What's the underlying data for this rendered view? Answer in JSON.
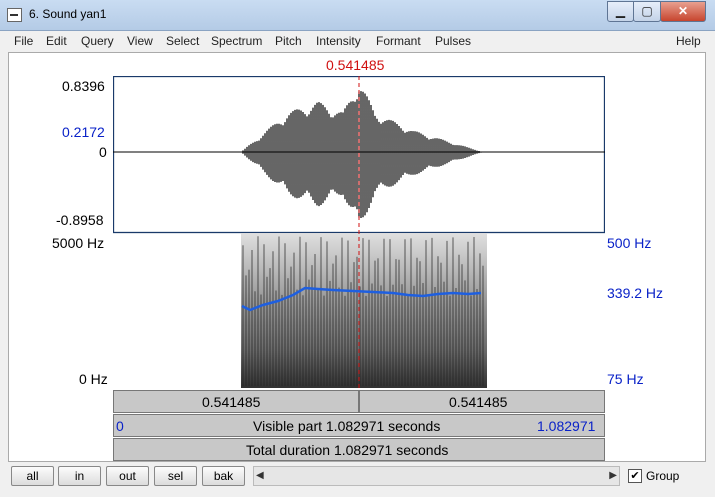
{
  "window": {
    "title": "6. Sound yan1",
    "minimize": "▁",
    "maximize": "▢",
    "close": "✕"
  },
  "menu": [
    "File",
    "Edit",
    "Query",
    "View",
    "Select",
    "Spectrum",
    "Pitch",
    "Intensity",
    "Formant",
    "Pulses"
  ],
  "help": "Help",
  "cursor_time": "0.541485",
  "waveform": {
    "ymax": "0.8396",
    "ymarker": "0.2172",
    "zero": "0",
    "ymin": "-0.8958"
  },
  "spectrogram": {
    "top_freq": "5000 Hz",
    "bottom_freq": "0 Hz"
  },
  "pitch": {
    "top": "500 Hz",
    "value": "339.2 Hz",
    "bottom": "75 Hz"
  },
  "time_bar": {
    "left": "0.541485",
    "right": "0.541485"
  },
  "visible_bar": {
    "start": "0",
    "text": "Visible part 1.082971 seconds",
    "end": "1.082971"
  },
  "total_bar": {
    "text": "Total duration 1.082971 seconds"
  },
  "buttons": [
    "all",
    "in",
    "out",
    "sel",
    "bak"
  ],
  "group": {
    "label": "Group",
    "checked": true
  }
}
